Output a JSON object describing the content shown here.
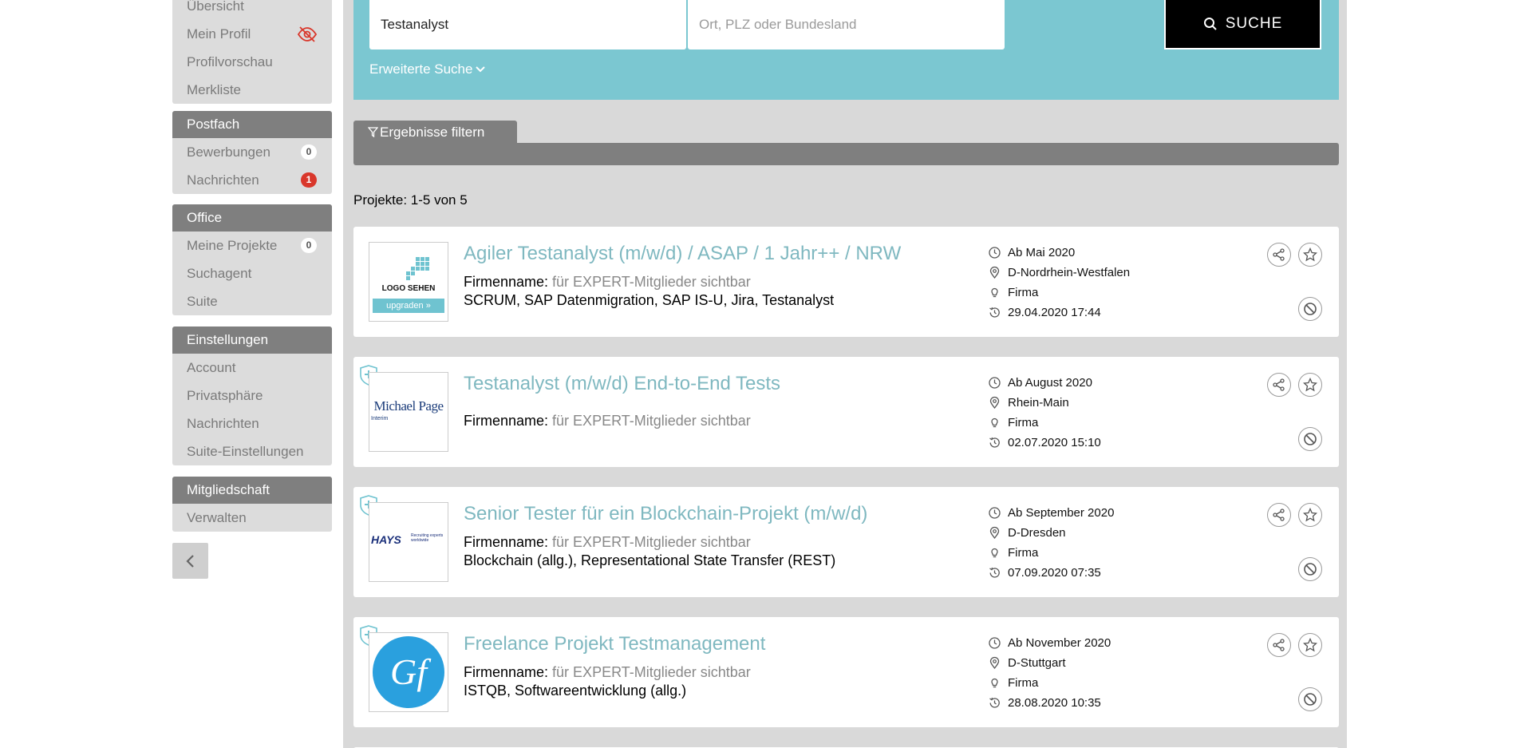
{
  "sidebar": {
    "profile_items": [
      {
        "label": "Übersicht"
      },
      {
        "label": "Mein Profil",
        "icon": "eye-off-icon"
      },
      {
        "label": "Profilvorschau"
      },
      {
        "label": "Merkliste"
      }
    ],
    "postfach": {
      "header": "Postfach",
      "items": [
        {
          "label": "Bewerbungen",
          "badge": "0"
        },
        {
          "label": "Nachrichten",
          "badge": "1"
        }
      ]
    },
    "office": {
      "header": "Office",
      "items": [
        {
          "label": "Meine Projekte",
          "badge": "0"
        },
        {
          "label": "Suchagent"
        },
        {
          "label": "Suite"
        }
      ]
    },
    "einstellungen": {
      "header": "Einstellungen",
      "items": [
        {
          "label": "Account"
        },
        {
          "label": "Privatsphäre"
        },
        {
          "label": "Nachrichten"
        },
        {
          "label": "Suite-Einstellungen"
        }
      ]
    },
    "mitgliedschaft": {
      "header": "Mitgliedschaft",
      "items": [
        {
          "label": "Verwalten"
        }
      ]
    }
  },
  "search": {
    "keyword_value": "Testanalyst",
    "location_placeholder": "Ort, PLZ oder Bundesland",
    "button_label": "SUCHE",
    "advanced_label": "Erweiterte Suche"
  },
  "filter": {
    "tab_label": "Ergebnisse filtern"
  },
  "results": {
    "count_text": "Projekte: 1-5 von 5",
    "items": [
      {
        "title": "Agiler Testanalyst (m/w/d) / ASAP / 1 Jahr++ / NRW",
        "company_label": "Firmenname:",
        "company_value": "für EXPERT-Mitglieder sichtbar",
        "tags": "SCRUM, SAP Datenmigration, SAP IS-U, Jira, Testanalyst",
        "start": "Ab Mai 2020",
        "location": "D-Nordrhein-Westfalen",
        "type": "Firma",
        "date": "29.04.2020 17:44",
        "logo": {
          "kind": "placeholder",
          "line1": "LOGO SEHEN",
          "line2": "upgraden »"
        }
      },
      {
        "title": "Testanalyst (m/w/d) End-to-End Tests",
        "company_label": "Firmenname:",
        "company_value": "für EXPERT-Mitglieder sichtbar",
        "tags": "",
        "start": "Ab August 2020",
        "location": "Rhein-Main",
        "type": "Firma",
        "date": "02.07.2020 15:10",
        "logo": {
          "kind": "michaelpage",
          "line1": "Michael Page",
          "line2": "Interim"
        }
      },
      {
        "title": "Senior Tester für ein Blockchain-Projekt (m/w/d)",
        "company_label": "Firmenname:",
        "company_value": "für EXPERT-Mitglieder sichtbar",
        "tags": "Blockchain (allg.), Representational State Transfer (REST)",
        "start": "Ab September 2020",
        "location": "D-Dresden",
        "type": "Firma",
        "date": "07.09.2020 07:35",
        "logo": {
          "kind": "hays",
          "line1": "HAYS",
          "line2": "Recruiting experts worldwide"
        }
      },
      {
        "title": "Freelance Projekt Testmanagement",
        "company_label": "Firmenname:",
        "company_value": "für EXPERT-Mitglieder sichtbar",
        "tags": "ISTQB, Softwareentwicklung (allg.)",
        "start": "Ab November 2020",
        "location": "D-Stuttgart",
        "type": "Firma",
        "date": "28.08.2020 10:35",
        "logo": {
          "kind": "gf",
          "line1": "Gf"
        }
      }
    ]
  },
  "colors": {
    "accent": "#7bc7d1",
    "title": "#7fb8c0",
    "header_gray": "#7f7f7f",
    "alert": "#d9372b"
  }
}
